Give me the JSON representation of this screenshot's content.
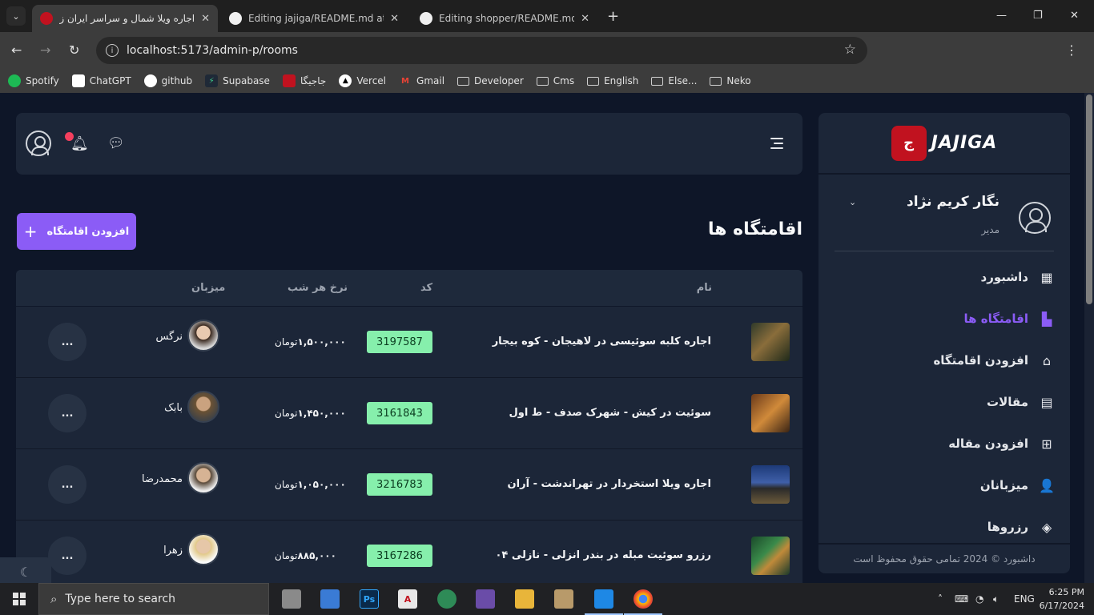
{
  "browser": {
    "tabs": [
      {
        "title": "اجاره ویلا شمال و سراسر ایران زیبا",
        "favicon": "jajiga-icon",
        "active": true
      },
      {
        "title": "Editing jajiga/README.md at m",
        "favicon": "github-icon",
        "active": false
      },
      {
        "title": "Editing shopper/README.md at",
        "favicon": "github-icon",
        "active": false
      }
    ],
    "url": "localhost:5173/admin-p/rooms",
    "bookmarks": [
      {
        "label": "Spotify",
        "type": "site",
        "icon": "spotify-icon"
      },
      {
        "label": "ChatGPT",
        "type": "site",
        "icon": "chatgpt-icon"
      },
      {
        "label": "github",
        "type": "site",
        "icon": "github-icon"
      },
      {
        "label": "Supabase",
        "type": "site",
        "icon": "supabase-icon"
      },
      {
        "label": "جاجیگا",
        "type": "site",
        "icon": "jajiga-icon"
      },
      {
        "label": "Vercel",
        "type": "site",
        "icon": "vercel-icon"
      },
      {
        "label": "Gmail",
        "type": "site",
        "icon": "gmail-icon"
      },
      {
        "label": "Developer",
        "type": "folder"
      },
      {
        "label": "Cms",
        "type": "folder"
      },
      {
        "label": "English",
        "type": "folder"
      },
      {
        "label": "Else...",
        "type": "folder"
      },
      {
        "label": "Neko",
        "type": "folder"
      }
    ]
  },
  "brand": {
    "logo_text": "JAJIGA",
    "accent": "#8b5cf6",
    "logo_color": "#c1121f"
  },
  "sidebar": {
    "user_name": "نگار کریم نژاد",
    "user_role": "مدیر",
    "items": [
      {
        "label": "داشبورد",
        "icon": "dashboard-icon",
        "active": false
      },
      {
        "label": "اقامتگاه ها",
        "icon": "building-icon",
        "active": true
      },
      {
        "label": "افزودن اقامتگاه",
        "icon": "home-add-icon",
        "active": false
      },
      {
        "label": "مقالات",
        "icon": "article-icon",
        "active": false
      },
      {
        "label": "افزودن مقاله",
        "icon": "add-box-icon",
        "active": false
      },
      {
        "label": "میزبانان",
        "icon": "host-icon",
        "active": false
      },
      {
        "label": "رزروها",
        "icon": "layers-icon",
        "active": false
      }
    ],
    "footer": "داشبورد © 2024 تمامی حقوق محفوظ است"
  },
  "page": {
    "title": "اقامتگاه ها",
    "add_button": "افزودن اقامتگاه"
  },
  "table": {
    "headers": {
      "name": "نام",
      "code": "کد",
      "price": "نرخ هر شب",
      "host": "میزبان"
    },
    "rows": [
      {
        "name": "اجاره کلبه سوئیسی در لاهیجان - کوه بیجار",
        "code": "3197587",
        "price": "۱,۵۰۰,۰۰۰",
        "unit": "تومان",
        "host": "نرگس",
        "more": "..."
      },
      {
        "name": "سوئیت در کیش - شهرک صدف - ط اول",
        "code": "3161843",
        "price": "۱,۴۵۰,۰۰۰",
        "unit": "تومان",
        "host": "بابک",
        "more": "..."
      },
      {
        "name": "اجاره ویلا استخردار در تهراندشت - آران",
        "code": "3216783",
        "price": "۱,۰۵۰,۰۰۰",
        "unit": "تومان",
        "host": "محمدرضا",
        "more": "..."
      },
      {
        "name": "رزرو سوئیت مبله در بندر انزلی - نازلی ۰۴",
        "code": "3167286",
        "price": "۸۸۵,۰۰۰",
        "unit": "تومان",
        "host": "زهرا",
        "more": "..."
      }
    ]
  },
  "taskbar": {
    "search_placeholder": "Type here to search",
    "language": "ENG",
    "time": "6:25 PM",
    "date": "6/17/2024"
  }
}
